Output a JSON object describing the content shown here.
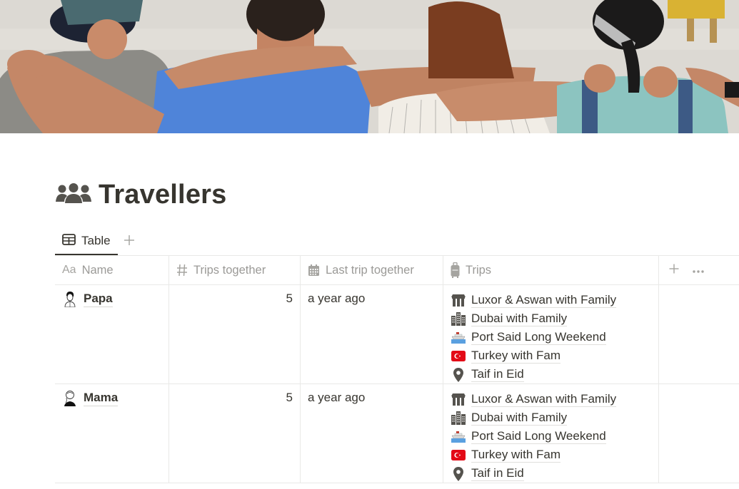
{
  "page": {
    "title": "Travellers",
    "title_icon": "people-group-icon",
    "cover": "friends-at-beach-photo"
  },
  "views": {
    "tabs": [
      {
        "label": "Table",
        "icon": "table-icon",
        "active": true
      }
    ],
    "add_view_icon": "plus-icon"
  },
  "table": {
    "columns": [
      {
        "label": "Name",
        "icon": "text-aa-icon"
      },
      {
        "label": "Trips together",
        "icon": "hash-icon"
      },
      {
        "label": "Last trip together",
        "icon": "calendar-icon"
      },
      {
        "label": "Trips",
        "icon": "luggage-icon"
      }
    ],
    "add_column_icon": "plus-icon",
    "more_icon": "ellipsis-icon",
    "rows": [
      {
        "name": "Papa",
        "avatar": "man-sketch-avatar",
        "trips_together": "5",
        "last_trip": "a year ago",
        "trips": [
          {
            "label": "Luxor & Aswan with Family",
            "icon": "temple-icon"
          },
          {
            "label": "Dubai with Family",
            "icon": "city-buildings-icon"
          },
          {
            "label": "Port Said Long Weekend",
            "icon": "ship-icon"
          },
          {
            "label": "Turkey with Fam",
            "icon": "turkey-flag-icon"
          },
          {
            "label": "Taif in Eid",
            "icon": "map-pin-icon"
          }
        ]
      },
      {
        "name": "Mama",
        "avatar": "woman-sketch-avatar",
        "trips_together": "5",
        "last_trip": "a year ago",
        "trips": [
          {
            "label": "Luxor & Aswan with Family",
            "icon": "temple-icon"
          },
          {
            "label": "Dubai with Family",
            "icon": "city-buildings-icon"
          },
          {
            "label": "Port Said Long Weekend",
            "icon": "ship-icon"
          },
          {
            "label": "Turkey with Fam",
            "icon": "turkey-flag-icon"
          },
          {
            "label": "Taif in Eid",
            "icon": "map-pin-icon"
          }
        ]
      }
    ]
  },
  "colors": {
    "text": "#37352f",
    "muted": "#9b9a97",
    "border": "#e9e9e7",
    "flag_red": "#e30a17"
  }
}
